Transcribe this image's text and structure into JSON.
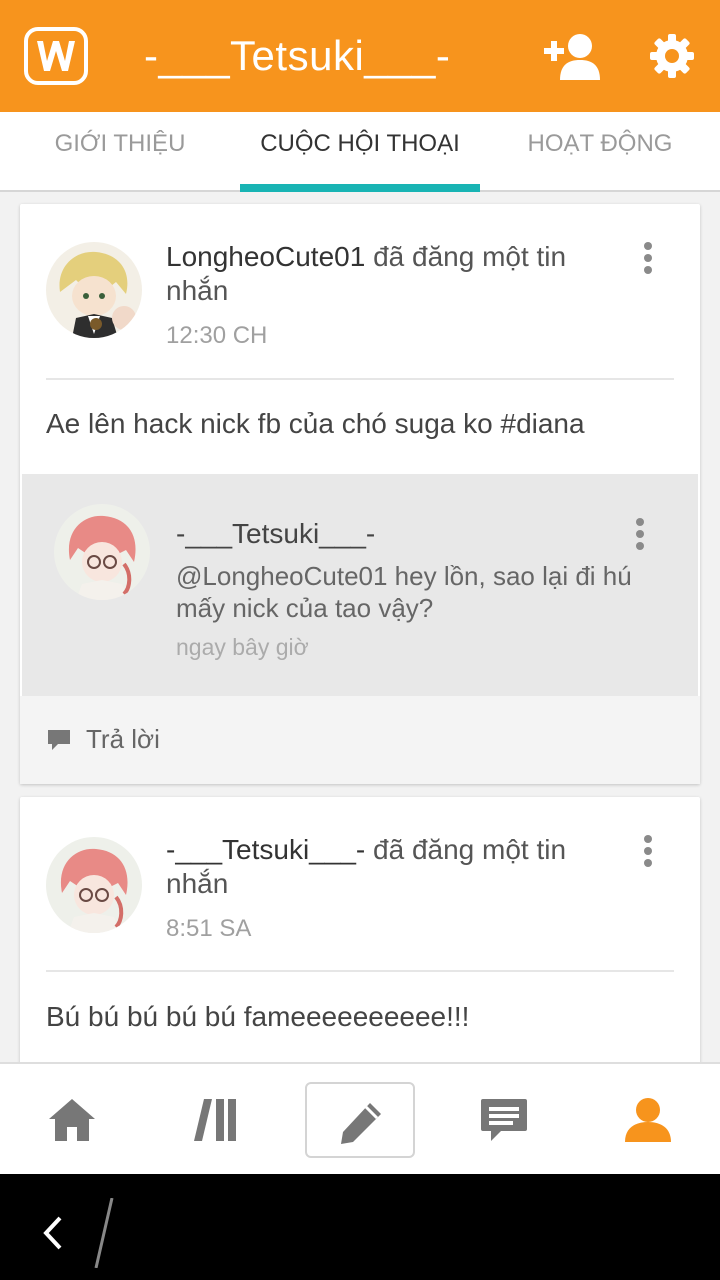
{
  "header": {
    "title": "-___Tetsuki___-",
    "brand_color": "#f7941d"
  },
  "tabs": [
    {
      "label": "GIỚI THIỆU",
      "active": false
    },
    {
      "label": "CUỘC HỘI THOẠI",
      "active": true
    },
    {
      "label": "HOẠT ĐỘNG",
      "active": false
    }
  ],
  "accent_color": "#18b4b4",
  "posts": [
    {
      "username": "LongheoCute01",
      "action": " đã đăng một tin nhắn",
      "time": "12:30 CH",
      "body": "Ae lên hack nick fb của chó suga ko #diana",
      "reply": {
        "username": "-___Tetsuki___-",
        "text": "@LongheoCute01  hey lồn, sao lại đi hú mấy nick của tao vậy?",
        "time": "ngay bây giờ"
      },
      "reply_label": "Trả lời"
    },
    {
      "username": "-___Tetsuki___-",
      "action": " đã đăng một tin nhắn",
      "time": "8:51 SA",
      "body": "Bú bú bú bú bú fameeeeeeeeee!!!"
    }
  ],
  "bottom_nav": [
    {
      "icon": "home-icon"
    },
    {
      "icon": "library-icon"
    },
    {
      "icon": "pencil-icon"
    },
    {
      "icon": "chat-icon"
    },
    {
      "icon": "profile-icon",
      "active": true
    }
  ]
}
